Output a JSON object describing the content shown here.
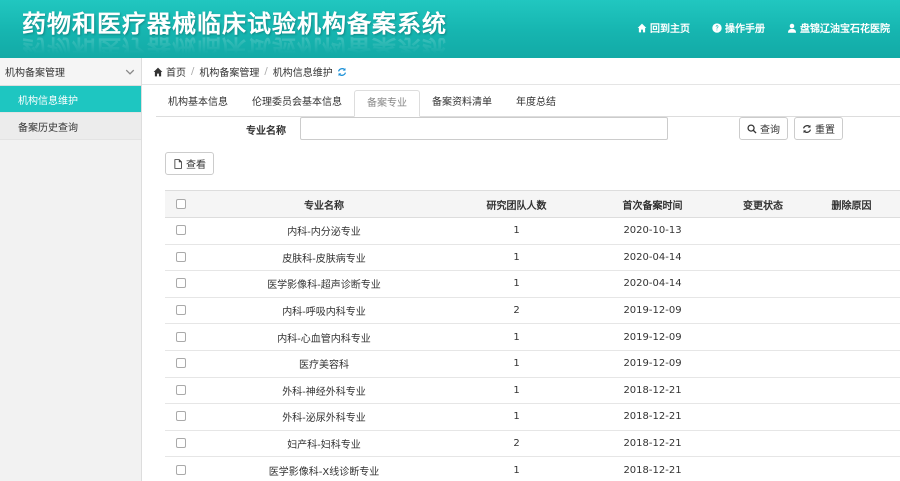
{
  "header": {
    "title": "药物和医疗器械临床试验机构备案系统",
    "nav": [
      {
        "label": "回到主页",
        "icon": "home-icon"
      },
      {
        "label": "操作手册",
        "icon": "question-circle-icon"
      },
      {
        "label": "盘锦辽油宝石花医院",
        "icon": "user-icon"
      }
    ]
  },
  "sidebar": {
    "group_label": "机构备案管理",
    "items": [
      {
        "label": "机构信息维护",
        "active": true
      },
      {
        "label": "备案历史查询",
        "active": false
      }
    ]
  },
  "breadcrumb": [
    "首页",
    "机构备案管理",
    "机构信息维护"
  ],
  "tabs": [
    {
      "label": "机构基本信息",
      "active": false
    },
    {
      "label": "伦理委员会基本信息",
      "active": false
    },
    {
      "label": "备案专业",
      "active": true
    },
    {
      "label": "备案资料清单",
      "active": false
    },
    {
      "label": "年度总结",
      "active": false
    }
  ],
  "search": {
    "label": "专业名称",
    "value": "",
    "query_button": "查询",
    "reset_button": "重置"
  },
  "view_button": "查看",
  "table": {
    "columns": [
      "专业名称",
      "研究团队人数",
      "首次备案时间",
      "变更状态",
      "删除原因"
    ],
    "rows": [
      {
        "name": "内科-内分泌专业",
        "team": "1",
        "date": "2020-10-13",
        "status": "",
        "reason": ""
      },
      {
        "name": "皮肤科-皮肤病专业",
        "team": "1",
        "date": "2020-04-14",
        "status": "",
        "reason": ""
      },
      {
        "name": "医学影像科-超声诊断专业",
        "team": "1",
        "date": "2020-04-14",
        "status": "",
        "reason": ""
      },
      {
        "name": "内科-呼吸内科专业",
        "team": "2",
        "date": "2019-12-09",
        "status": "",
        "reason": ""
      },
      {
        "name": "内科-心血管内科专业",
        "team": "1",
        "date": "2019-12-09",
        "status": "",
        "reason": ""
      },
      {
        "name": "医疗美容科",
        "team": "1",
        "date": "2019-12-09",
        "status": "",
        "reason": ""
      },
      {
        "name": "外科-神经外科专业",
        "team": "1",
        "date": "2018-12-21",
        "status": "",
        "reason": ""
      },
      {
        "name": "外科-泌尿外科专业",
        "team": "1",
        "date": "2018-12-21",
        "status": "",
        "reason": ""
      },
      {
        "name": "妇产科-妇科专业",
        "team": "2",
        "date": "2018-12-21",
        "status": "",
        "reason": ""
      },
      {
        "name": "医学影像科-X线诊断专业",
        "team": "1",
        "date": "2018-12-21",
        "status": "",
        "reason": ""
      }
    ]
  },
  "colors": {
    "accent": "#1ec6c1",
    "header": "#16b5b0"
  }
}
